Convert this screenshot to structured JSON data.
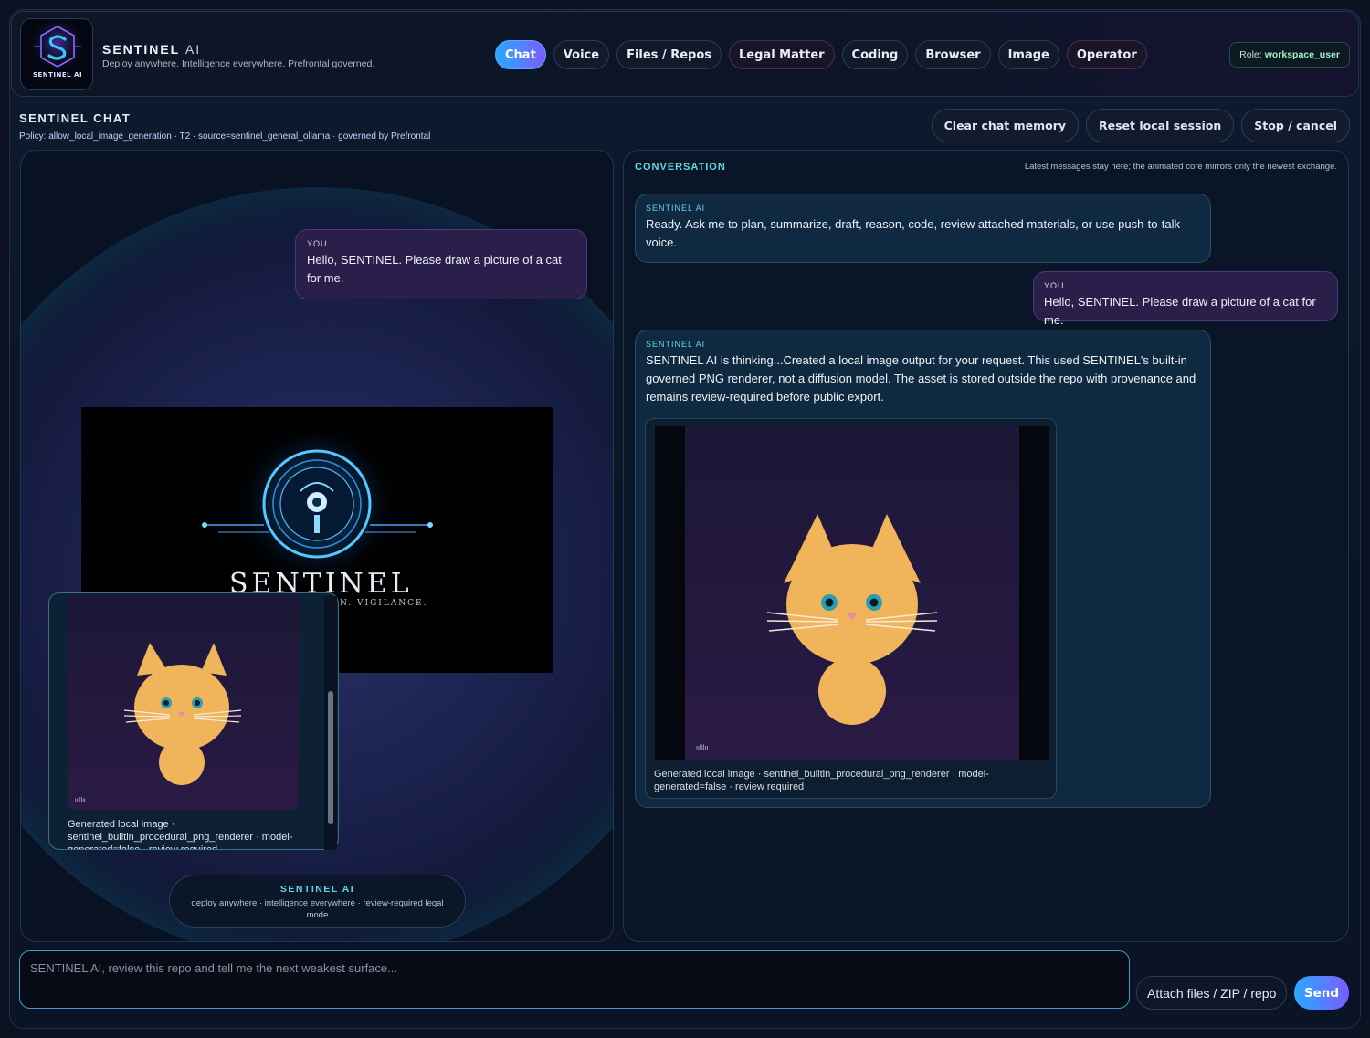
{
  "brand": {
    "name": "SENTINEL",
    "suffix": "AI",
    "tagline": "Deploy anywhere. Intelligence everywhere. Prefrontal governed.",
    "logo_text": "SENTINEL AI"
  },
  "tabs": [
    {
      "label": "Chat",
      "active": true
    },
    {
      "label": "Voice"
    },
    {
      "label": "Files / Repos"
    },
    {
      "label": "Legal Matter"
    },
    {
      "label": "Coding"
    },
    {
      "label": "Browser"
    },
    {
      "label": "Image"
    },
    {
      "label": "Operator"
    }
  ],
  "role": {
    "prefix": "Role:",
    "value": "workspace_user"
  },
  "chat": {
    "title": "SENTINEL CHAT",
    "policy": "Policy: allow_local_image_generation · T2 · source=sentinel_general_ollama · governed by Prefrontal",
    "actions": {
      "clear": "Clear chat memory",
      "reset": "Reset local session",
      "stop": "Stop / cancel"
    }
  },
  "stage": {
    "you_label": "YOU",
    "you_message": "Hello, SENTINEL. Please draw a picture of a cat for me.",
    "hero_word": "SENTINEL",
    "hero_tagline": "N. VIGILANCE.",
    "thumb_caption": "Generated local image · sentinel_builtin_procedural_png_renderer · model-generated=false · review required",
    "footer_title": "SENTINEL AI",
    "footer_sub": "deploy anywhere · intelligence everywhere · review-required legal mode"
  },
  "conversation": {
    "title": "CONVERSATION",
    "note": "Latest messages stay here; the animated core mirrors only the newest exchange.",
    "messages": [
      {
        "label": "SENTINEL AI",
        "text": "Ready. Ask me to plan, summarize, draft, reason, code, review attached materials, or use push-to-talk voice."
      },
      {
        "label": "YOU",
        "text": "Hello, SENTINEL. Please draw a picture of a cat for me."
      },
      {
        "label": "SENTINEL AI",
        "text": "SENTINEL AI is thinking...Created a local image output for your request. This used SENTINEL's built-in governed PNG renderer, not a diffusion model. The asset is stored outside the repo with provenance and remains review-required before public export."
      }
    ],
    "image_caption": "Generated local image · sentinel_builtin_procedural_png_renderer · model-generated=false · review required"
  },
  "composer": {
    "placeholder": "SENTINEL AI, review this repo and tell me the next weakest surface...",
    "attach_label": "Attach files / ZIP / repo",
    "send_label": "Send"
  },
  "colors": {
    "accent_cyan": "#5fd8e6",
    "accent_gradient_start": "#2aa9ff",
    "accent_gradient_end": "#7a5cff",
    "user_bubble": "#2a1f4a",
    "ai_bubble": "#0f2a40",
    "cat_fill": "#f0b45a"
  }
}
